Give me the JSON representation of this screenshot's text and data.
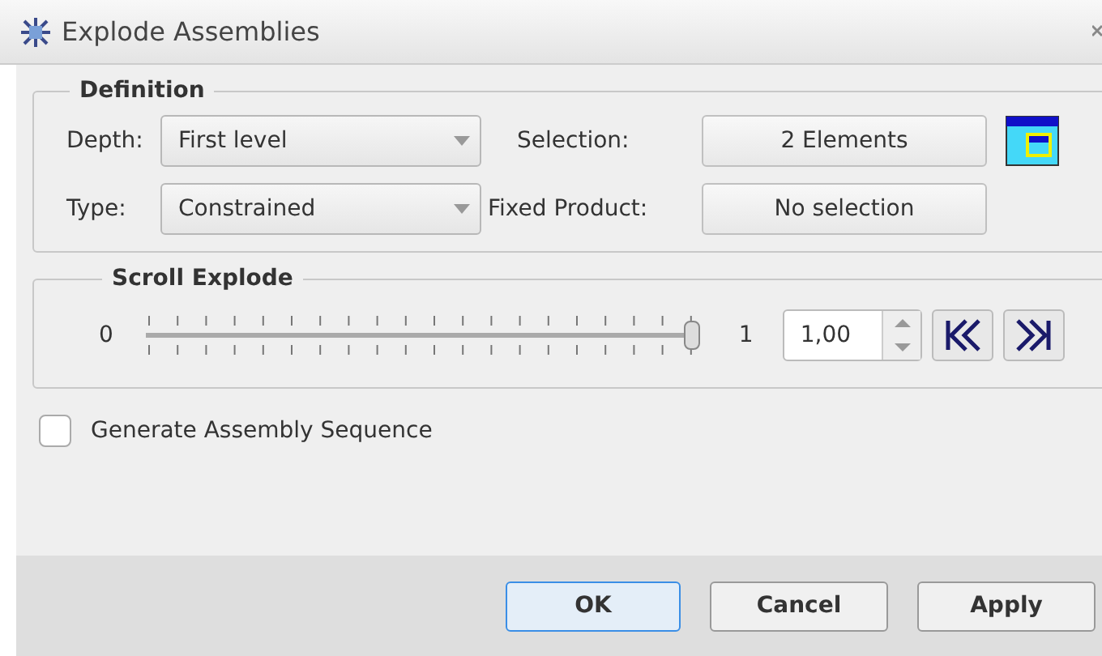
{
  "window": {
    "title": "Explode Assemblies"
  },
  "definition": {
    "title": "Definition",
    "depth": {
      "label": "Depth:",
      "value": "First level"
    },
    "type": {
      "label": "Type:",
      "value": "Constrained"
    },
    "selection": {
      "label": "Selection:",
      "value": "2 Elements"
    },
    "fixed_product": {
      "label": "Fixed Product:",
      "value": "No selection"
    }
  },
  "scroll_explode": {
    "title": "Scroll Explode",
    "min_label": "0",
    "max_label": "1",
    "level": 1.0,
    "value": "1,00"
  },
  "generate_sequence": {
    "label": "Generate Assembly Sequence",
    "checked": false
  },
  "buttons": [
    {
      "label": "OK",
      "default": true
    },
    {
      "label": "Cancel",
      "default": false
    },
    {
      "label": "Apply",
      "default": false
    }
  ]
}
